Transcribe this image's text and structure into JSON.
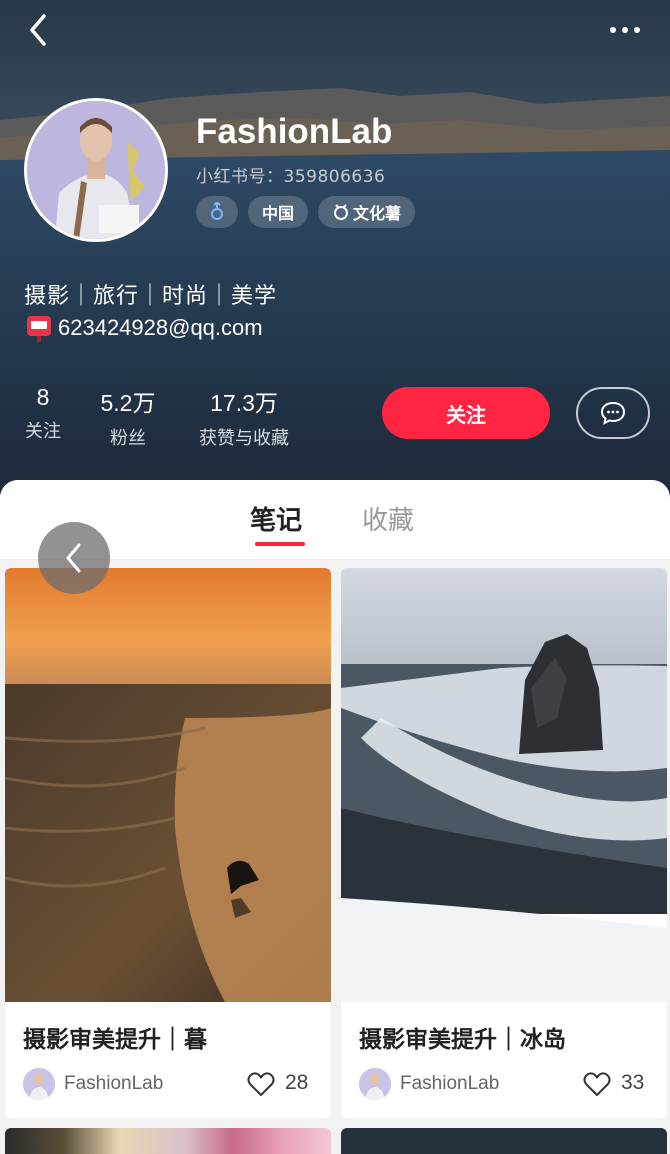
{
  "profile": {
    "nickname": "FashionLab",
    "red_id": "小红书号：359806636",
    "tags": {
      "gender_icon": "male-icon",
      "region": "中国",
      "tag3": "文化薯"
    },
    "bio": "摄影｜旅行｜时尚｜美学",
    "email": "623424928@qq.com",
    "stats": [
      {
        "value": "8",
        "label": "关注"
      },
      {
        "value": "5.2万",
        "label": "粉丝"
      },
      {
        "value": "17.3万",
        "label": "获赞与收藏"
      }
    ],
    "follow_label": "关注"
  },
  "tabs": [
    {
      "label": "笔记",
      "active": true
    },
    {
      "label": "收藏",
      "active": false
    }
  ],
  "notes": [
    {
      "title": "摄影审美提升｜暮",
      "author": "FashionLab",
      "likes": "28"
    },
    {
      "title": "摄影审美提升｜冰岛",
      "author": "FashionLab",
      "likes": "33"
    }
  ],
  "colors": {
    "accent": "#ff2442",
    "header_bg": "#24354a"
  }
}
